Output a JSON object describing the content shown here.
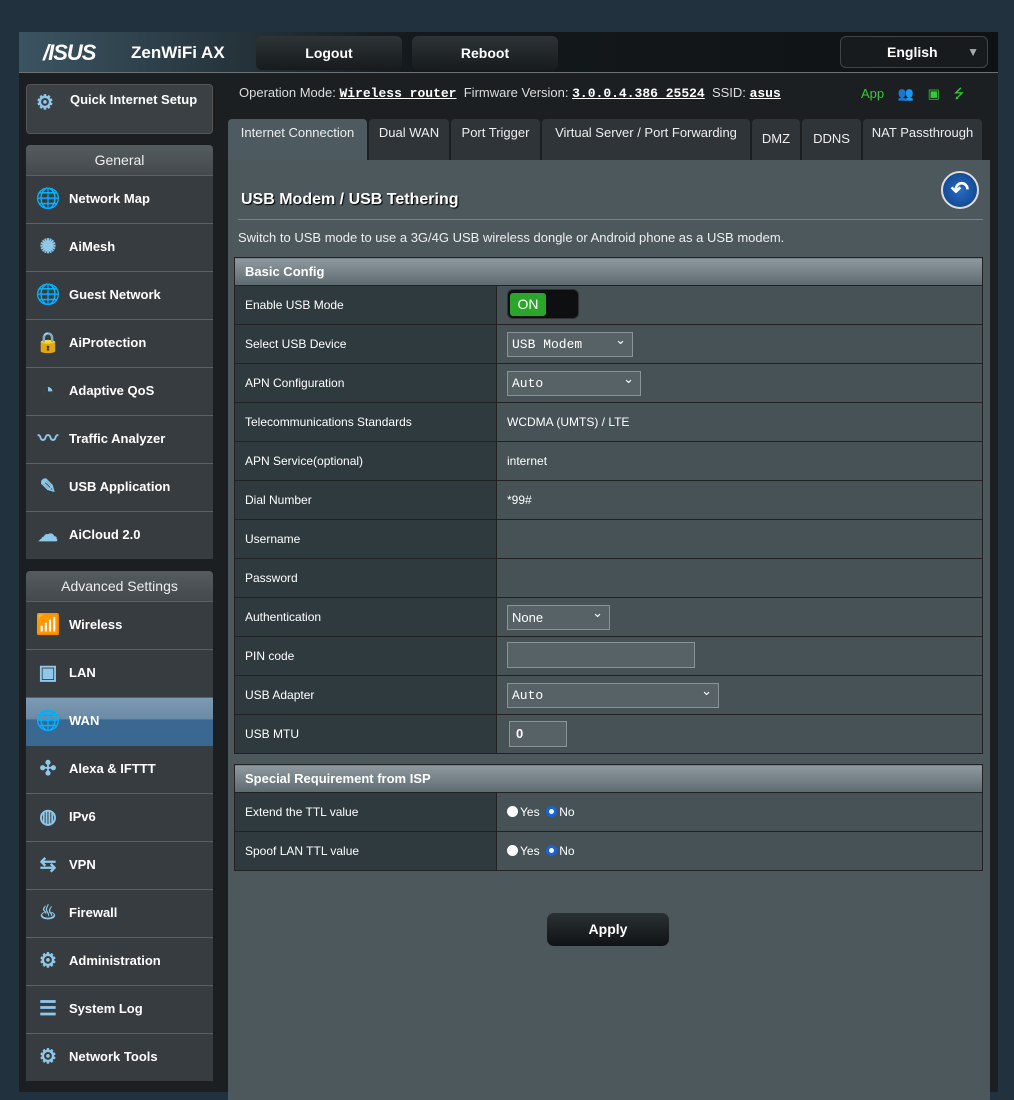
{
  "header": {
    "brand": "/ISUS",
    "product": "ZenWiFi AX",
    "logout": "Logout",
    "reboot": "Reboot",
    "language": "English"
  },
  "status": {
    "mode_label": "Operation Mode:",
    "mode": "Wireless router",
    "fw_label": "Firmware Version:",
    "fw": "3.0.0.4.386_25524",
    "ssid_label": "SSID:",
    "ssid": "asus",
    "app": "App"
  },
  "sidebar": {
    "qis": "Quick Internet Setup",
    "general_title": "General",
    "general": [
      {
        "label": "Network Map",
        "icon": "🌐"
      },
      {
        "label": "AiMesh",
        "icon": "✺"
      },
      {
        "label": "Guest Network",
        "icon": "🌐"
      },
      {
        "label": "AiProtection",
        "icon": "🔒"
      },
      {
        "label": "Adaptive QoS",
        "icon": "◔"
      },
      {
        "label": "Traffic Analyzer",
        "icon": "〰"
      },
      {
        "label": "USB Application",
        "icon": "✎"
      },
      {
        "label": "AiCloud 2.0",
        "icon": "☁"
      }
    ],
    "advanced_title": "Advanced Settings",
    "advanced": [
      {
        "label": "Wireless",
        "icon": "📶"
      },
      {
        "label": "LAN",
        "icon": "▣"
      },
      {
        "label": "WAN",
        "icon": "🌐",
        "active": true
      },
      {
        "label": "Alexa & IFTTT",
        "icon": "✣"
      },
      {
        "label": "IPv6",
        "icon": "◍"
      },
      {
        "label": "VPN",
        "icon": "⇆"
      },
      {
        "label": "Firewall",
        "icon": "♨"
      },
      {
        "label": "Administration",
        "icon": "⚙"
      },
      {
        "label": "System Log",
        "icon": "☰"
      },
      {
        "label": "Network Tools",
        "icon": "⚙"
      }
    ]
  },
  "tabs": [
    "Internet Connection",
    "Dual WAN",
    "Port Trigger",
    "Virtual Server / Port Forwarding",
    "DMZ",
    "DDNS",
    "NAT Passthrough"
  ],
  "page": {
    "title": "USB Modem / USB Tethering",
    "description": "Switch to USB mode to use a 3G/4G USB wireless dongle or Android phone as a USB modem.",
    "apply": "Apply"
  },
  "basic": {
    "title": "Basic Config",
    "enable_label": "Enable USB Mode",
    "enable_value": "ON",
    "device_label": "Select USB Device",
    "device_value": "USB Modem",
    "apn_label": "APN Configuration",
    "apn_value": "Auto",
    "telecom_label": "Telecommunications Standards",
    "telecom_value": "WCDMA (UMTS) / LTE",
    "apn_service_label": "APN Service(optional)",
    "apn_service_value": "internet",
    "dial_label": "Dial Number",
    "dial_value": "*99#",
    "username_label": "Username",
    "username_value": "",
    "password_label": "Password",
    "password_value": "",
    "auth_label": "Authentication",
    "auth_value": "None",
    "pin_label": "PIN code",
    "pin_value": "",
    "adapter_label": "USB Adapter",
    "adapter_value": "Auto",
    "mtu_label": "USB MTU",
    "mtu_value": "0"
  },
  "isp": {
    "title": "Special Requirement from ISP",
    "ttl_label": "Extend the TTL value",
    "spoof_label": "Spoof LAN TTL value",
    "yes": "Yes",
    "no": "No",
    "ttl_value": "No",
    "spoof_value": "No"
  },
  "colors": {
    "accent": "#2aa62a",
    "active_nav": "#3a6891",
    "radio": "#1463e0"
  }
}
